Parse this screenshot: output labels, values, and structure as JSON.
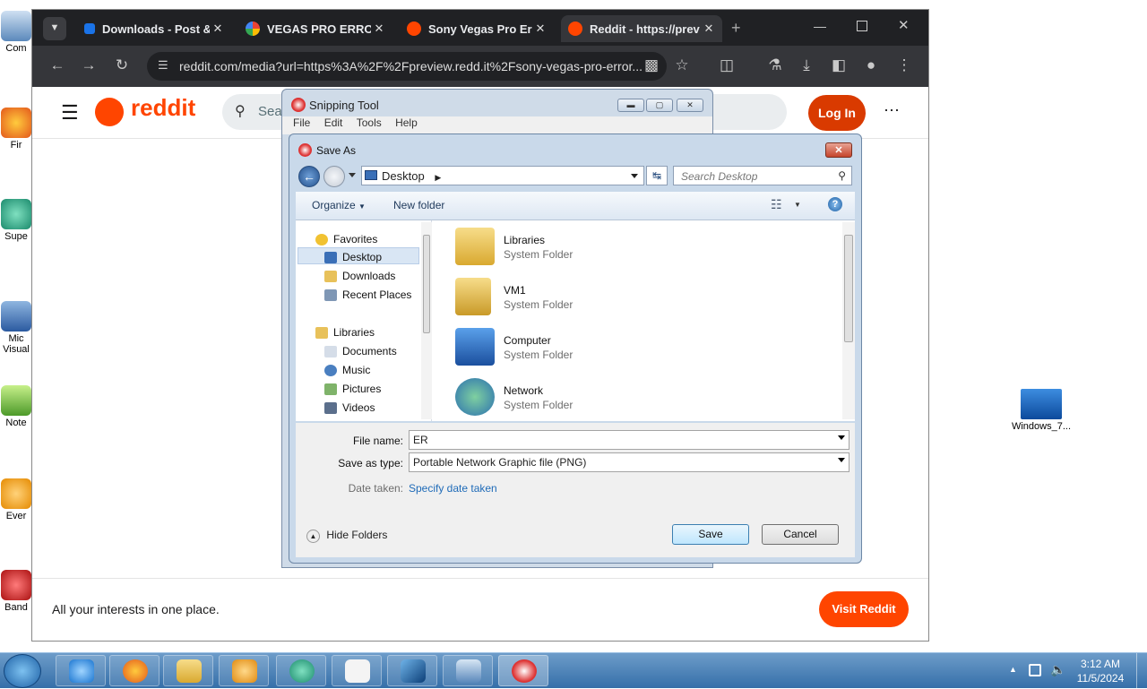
{
  "desktop": {
    "icons": [
      {
        "label": "Com"
      },
      {
        "label": "Fir"
      },
      {
        "label": "Supe"
      },
      {
        "label": "Mic Visual"
      },
      {
        "label": "Note"
      },
      {
        "label": "Ever"
      },
      {
        "label": "Band"
      },
      {
        "label": "Windows_7..."
      }
    ]
  },
  "browser": {
    "tabs": [
      {
        "title": "Downloads - Post &",
        "active": false
      },
      {
        "title": "VEGAS PRO ERROR",
        "active": false
      },
      {
        "title": "Sony Vegas Pro Error",
        "active": false
      },
      {
        "title": "Reddit - https://prev",
        "active": true
      }
    ],
    "url": "reddit.com/media?url=https%3A%2F%2Fpreview.redd.it%2Fsony-vegas-pro-error..."
  },
  "reddit": {
    "wordmark": "reddit",
    "search_placeholder": "Sear",
    "login_label": "Log In",
    "footer_text": "All your interests in one place.",
    "visit_label": "Visit Reddit"
  },
  "snipping_tool": {
    "title": "Snipping Tool",
    "menu": [
      "File",
      "Edit",
      "Tools",
      "Help"
    ]
  },
  "save_dialog": {
    "title": "Save As",
    "location": "Desktop",
    "search_placeholder": "Search Desktop",
    "organize_label": "Organize",
    "new_folder_label": "New folder",
    "nav": {
      "favorites_label": "Favorites",
      "favorites": [
        "Desktop",
        "Downloads",
        "Recent Places"
      ],
      "libraries_label": "Libraries",
      "libraries": [
        "Documents",
        "Music",
        "Pictures",
        "Videos"
      ],
      "selected": "Desktop"
    },
    "items": [
      {
        "name": "Libraries",
        "type": "System Folder",
        "icon": "libraries-folder-icon"
      },
      {
        "name": "VM1",
        "type": "System Folder",
        "icon": "user-folder-icon"
      },
      {
        "name": "Computer",
        "type": "System Folder",
        "icon": "computer-icon"
      },
      {
        "name": "Network",
        "type": "System Folder",
        "icon": "network-icon"
      }
    ],
    "file_name_label": "File name:",
    "file_name_value": "ER",
    "save_type_label": "Save as type:",
    "save_type_value": "Portable Network Graphic file (PNG)",
    "date_taken_label": "Date taken:",
    "date_taken_link": "Specify date taken",
    "hide_folders_label": "Hide Folders",
    "save_label": "Save",
    "cancel_label": "Cancel"
  },
  "taskbar": {
    "time": "3:12 AM",
    "date": "11/5/2024"
  },
  "colors": {
    "reddit_orange": "#ff4500",
    "login_red": "#d93a00",
    "link_blue": "#1f6bb8",
    "chrome_dark": "#202124"
  }
}
